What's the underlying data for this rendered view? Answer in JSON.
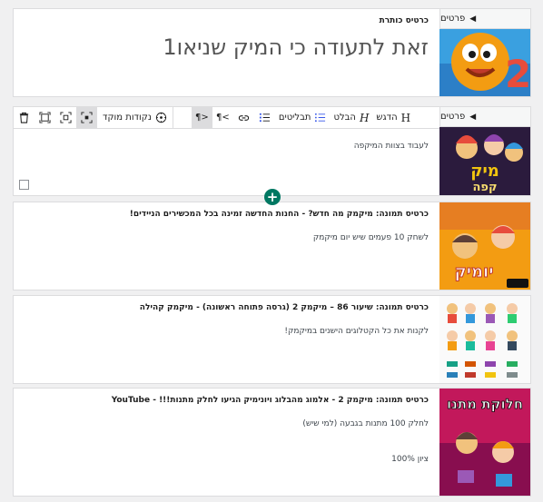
{
  "cards": [
    {
      "kind": "title",
      "thumb_label": "פרטים",
      "title": "כרטיס כותרת",
      "big_text": "זאת לתעודה כי המיק שניאו1"
    },
    {
      "kind": "editing",
      "thumb_label": "פרטים",
      "body": "לעבוד בצוות המיקפה"
    },
    {
      "kind": "image",
      "title": "כרטיס תמונה: מיקמק מה חדש? - החנות החדשה זמינה בכל המכשירים הניידים!",
      "lines": [
        "לשחק 10 פעמים שיש יום מיקמק"
      ]
    },
    {
      "kind": "image",
      "title": "כרטיס תמונה: שיעור 86 – מיקמק 2 (גרסה פתוחה ראשונה) - מיקמק קהילה",
      "lines": [
        "לקנות את כל הקטלוגים הישנים במיקמק!"
      ]
    },
    {
      "kind": "image",
      "title": "כרטיס תמונה: מיקמק 2 - אלמוג מהבלוג ויונימיק הגיעו לחלק מתנות!!! - YouTube",
      "lines": [
        "לחלק 100 מתנות בגבעה (למי שיש)",
        "ציון 100%"
      ]
    }
  ],
  "toolbar": {
    "heading_label": "H",
    "highlight_label": "הדגש",
    "italic_label": "H",
    "emphasis_label": "הבלט",
    "bullets_label": "תבליטים",
    "rtl_label": "¶>",
    "ltr_label": "¶<",
    "focus_label": "נקודות מוקד"
  },
  "thumb_images": {
    "title": "mickey-2-orange-character",
    "editing": "mickmack-café-poster",
    "card3": "mickmack-game-poster",
    "card4": "mickmack-catalog-items",
    "card5": "gift-distribution-poster"
  },
  "colors": {
    "accent": "#007862",
    "pressed": "#dcdcde",
    "border": "#dcdcde"
  }
}
